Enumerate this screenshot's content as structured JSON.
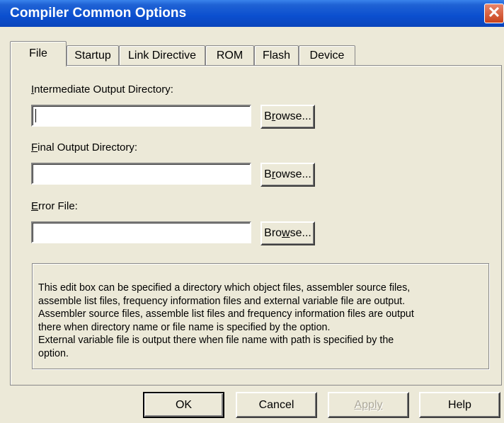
{
  "window": {
    "title": "Compiler Common Options",
    "close_glyph": "✕"
  },
  "tabs": [
    {
      "label": "File",
      "active": true
    },
    {
      "label": "Startup",
      "active": false
    },
    {
      "label": "Link Directive",
      "active": false
    },
    {
      "label": "ROM",
      "active": false
    },
    {
      "label": "Flash",
      "active": false
    },
    {
      "label": "Device",
      "active": false
    }
  ],
  "fields": {
    "intermediate": {
      "label_mnemonic": "I",
      "label_rest": "ntermediate Output Directory:",
      "value": "",
      "browse_pre": "B",
      "browse_mnemonic": "r",
      "browse_post": "owse..."
    },
    "final": {
      "label_mnemonic": "F",
      "label_rest": "inal Output Directory:",
      "value": "",
      "browse_pre": "B",
      "browse_mnemonic": "r",
      "browse_post": "owse..."
    },
    "error": {
      "label_mnemonic": "E",
      "label_rest": "rror File:",
      "value": "",
      "browse_pre": "Bro",
      "browse_mnemonic": "w",
      "browse_post": "se..."
    }
  },
  "description": {
    "lines": [
      "This edit box can be specified a directory which object files, assembler source files,",
      "assemble list files, frequency information files and external variable file are output.",
      "Assembler source files, assemble list files and frequency information files are output",
      "there when directory name or file name is specified by the option.",
      "External variable file is output there when file name with path is specified by the",
      "option."
    ]
  },
  "buttons": {
    "ok": "OK",
    "cancel": "Cancel",
    "apply": "Apply",
    "help": "Help"
  }
}
